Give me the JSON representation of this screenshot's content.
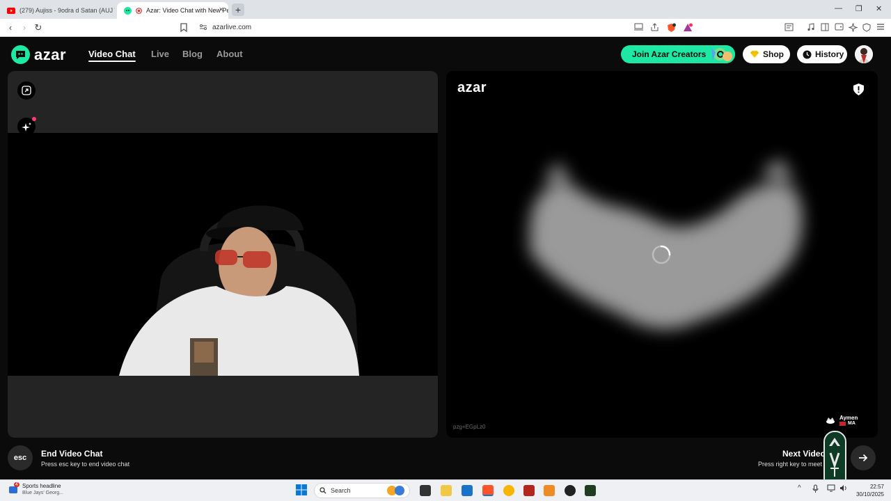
{
  "browser": {
    "tabs": [
      {
        "title": "(279) Aujiss - 9odra d Satan (AUJ TH",
        "active": false,
        "icon": "youtube-icon"
      },
      {
        "title": "Azar: Video Chat with New Pe",
        "active": true,
        "icon": "azar-favicon"
      }
    ],
    "new_tab_label": "+",
    "url": "azarlive.com"
  },
  "site": {
    "logo_text": "azar",
    "nav": [
      {
        "label": "Video Chat",
        "active": true
      },
      {
        "label": "Live",
        "active": false
      },
      {
        "label": "Blog",
        "active": false
      },
      {
        "label": "About",
        "active": false
      }
    ],
    "join_creators": "Join Azar Creators",
    "shop": "Shop",
    "history": "History",
    "accent_color": "#1de9a4"
  },
  "remote": {
    "watermark": "azar",
    "code": "pzg+EGpLz0",
    "peer_name": "Aymen",
    "peer_country": "MA"
  },
  "bottom": {
    "esc_key": "esc",
    "end_title": "End Video Chat",
    "end_sub": "Press esc key to end video chat",
    "next_title": "Next Video",
    "next_sub": "Press right key to meet"
  },
  "taskbar": {
    "news_title": "Sports headline",
    "news_sub": "Blue Jays' Georg...",
    "news_badge": "4",
    "search_label": "Search",
    "time": "22:57",
    "date": "30/10/2025"
  }
}
